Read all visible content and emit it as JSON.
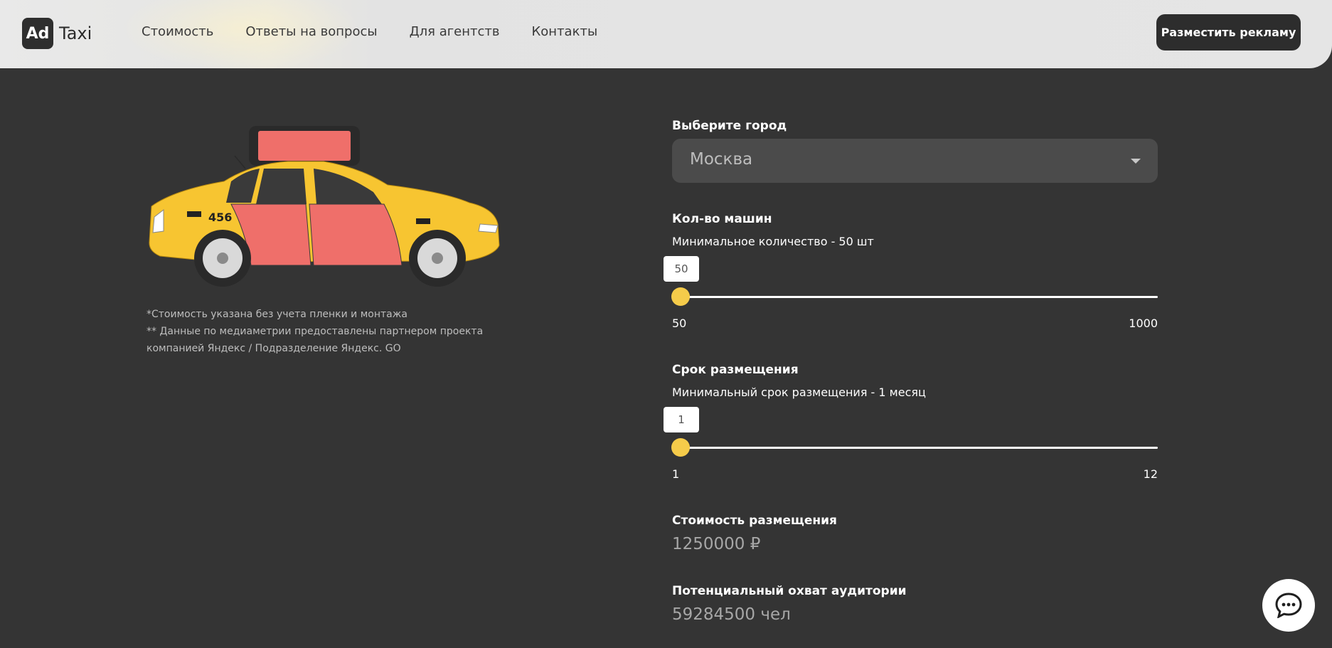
{
  "header": {
    "logo_box": "Ad",
    "logo_text": "Taxi",
    "nav": [
      "Стоимость",
      "Ответы на вопросы",
      "Для агентств",
      "Контакты"
    ],
    "cta_label": "Разместить рекламу"
  },
  "car": {
    "number": "456"
  },
  "notes": [
    "*Стоимость указана без учета пленки и монтажа",
    "** Данные по медиаметрии предоставлены партнером проекта",
    "компанией Яндекс / Подразделение Яндекс. GO"
  ],
  "form": {
    "city_label": "Выберите город",
    "city_value": "Москва",
    "cars_label": "Кол-во машин",
    "cars_hint": "Минимальное количество - 50 шт",
    "cars_value": "50",
    "cars_min": "50",
    "cars_max": "1000",
    "term_label": "Срок размещения",
    "term_hint": "Минимальный срок размещения - 1 месяц",
    "term_value": "1",
    "term_min": "1",
    "term_max": "12",
    "cost_label": "Стоимость размещения",
    "cost_value": "1250000 ₽",
    "reach_label": "Потенциальный охват аудитории",
    "reach_value": "59284500 чел"
  },
  "colors": {
    "background": "#343434",
    "accent_yellow": "#f5cb4a",
    "ad_panel": "#ef6f6a",
    "header": "#e6e6e6"
  },
  "icons": [
    "chevron-down-icon",
    "chat-icon"
  ]
}
